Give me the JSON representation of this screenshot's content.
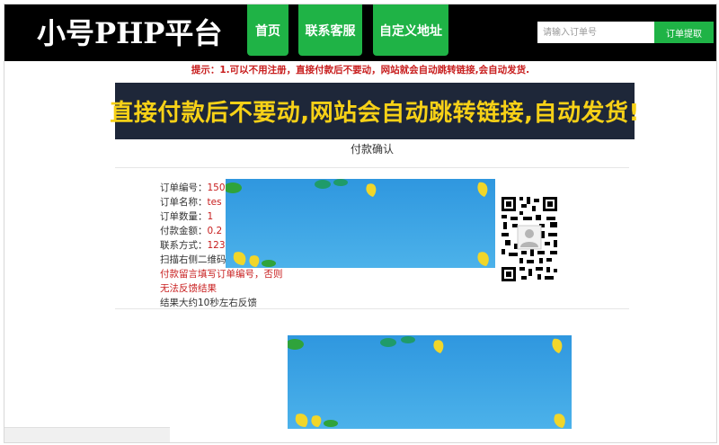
{
  "header": {
    "logo": "小号PHP平台",
    "nav": [
      {
        "label": "首页"
      },
      {
        "label": "联系客服"
      },
      {
        "label": "自定义地址"
      }
    ],
    "search": {
      "placeholder": "请输入订单号",
      "button_label": "订单提取"
    }
  },
  "tip": "提示：1.可以不用注册，直接付款后不要动，网站就会自动跳转链接,会自动发货.",
  "banner": "直接付款后不要动,网站会自动跳转链接,自动发货!",
  "section_title": "付款确认",
  "order": {
    "number_label": "订单编号：",
    "number_value": "150",
    "name_label": "订单名称：",
    "name_value": "tes",
    "qty_label": "订单数量：",
    "qty_value": "1",
    "amount_label": "付款金额：",
    "amount_value": "0.2",
    "contact_label": "联系方式：",
    "contact_value": "123",
    "scan_text": "扫描右侧二维码",
    "note_text": "付款留言填写订单编号，否则",
    "no_feedback_text": "无法反馈结果",
    "result_text": "结果大约10秒左右反馈"
  },
  "colors": {
    "accent": "#1fb346",
    "header_bg": "#000000",
    "banner_bg": "#1e2739",
    "banner_text": "#f7d117",
    "warning": "#c81e1e"
  },
  "icons": [
    "qr-code-icon",
    "user-avatar-icon"
  ]
}
